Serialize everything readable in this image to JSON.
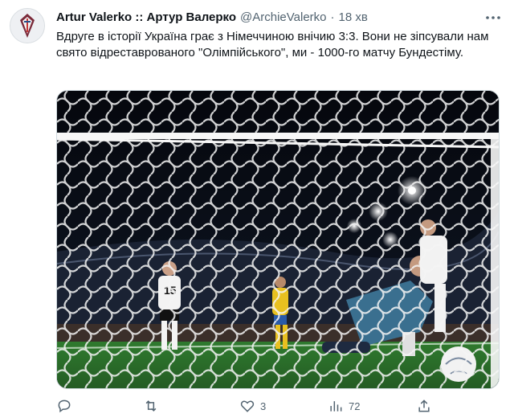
{
  "tweet": {
    "author_name": "Artur Valerko :: Артур Валерко",
    "handle": "@ArchieValerko",
    "separator": "·",
    "time": "18 хв",
    "text": "Вдруге в історії Україна грає з Німеччиною внічию 3:3. Вони не зіпсували нам свято відреставрованого \"Олімпійського\", ми - 1000-го матчу Бундестіму.",
    "image": {
      "jersey_number": "15"
    }
  },
  "actions": {
    "reply_count": "",
    "retweet_count": "",
    "like_count": "3",
    "view_count": "72"
  },
  "icons": {
    "more": "more-icon",
    "reply": "reply-icon",
    "retweet": "retweet-icon",
    "like": "heart-icon",
    "views": "views-icon",
    "share": "share-icon"
  },
  "colors": {
    "text": "#0f1419",
    "secondary": "#536471",
    "border": "#cfd9de",
    "pitch": "#2f7a2e",
    "keeper": "#3a6f8f",
    "ukraine_yellow": "#e8c020"
  }
}
